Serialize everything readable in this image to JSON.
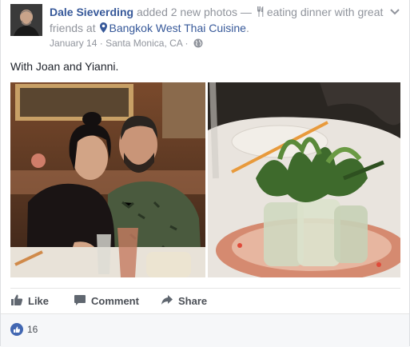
{
  "header": {
    "author": "Dale Sieverding",
    "action": "added 2 new photos — ",
    "activity": "eating dinner with great friends at",
    "place": "Bangkok West Thai Cuisine",
    "period": ".",
    "date": "January 14",
    "sep1": "·",
    "location": "Santa Monica, CA",
    "sep2": "·"
  },
  "post": {
    "text": "With Joan and Yianni."
  },
  "actions": {
    "like": "Like",
    "comment": "Comment",
    "share": "Share"
  },
  "reactions": {
    "count": "16"
  },
  "colors": {
    "link": "#365899",
    "muted": "#90949c",
    "like_blue": "#4267b2"
  },
  "icons": [
    "chevron-down-icon",
    "fork-knife-icon",
    "location-pin-icon",
    "globe-icon",
    "thumbs-up-icon",
    "comment-icon",
    "share-icon",
    "like-reaction-icon"
  ]
}
